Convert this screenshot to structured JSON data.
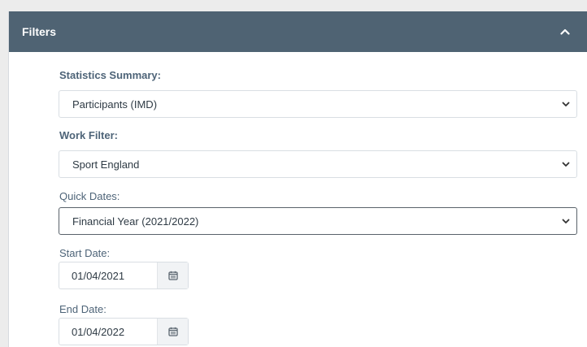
{
  "filters": {
    "title": "Filters",
    "collapse_icon": "chevron-up-icon",
    "statistics_summary": {
      "label": "Statistics Summary:",
      "value": "Participants (IMD)"
    },
    "work_filter": {
      "label": "Work Filter:",
      "value": "Sport England"
    },
    "quick_dates": {
      "label": "Quick Dates:",
      "value": "Financial Year (2021/2022)"
    },
    "start_date": {
      "label": "Start Date:",
      "value": "01/04/2021",
      "icon": "calendar-icon"
    },
    "end_date": {
      "label": "End Date:",
      "value": "01/04/2022",
      "icon": "calendar-icon"
    }
  },
  "colors": {
    "header_bg": "#4f6373",
    "label": "#4e6478",
    "border": "#d9dee3",
    "active_border": "#59626a"
  }
}
